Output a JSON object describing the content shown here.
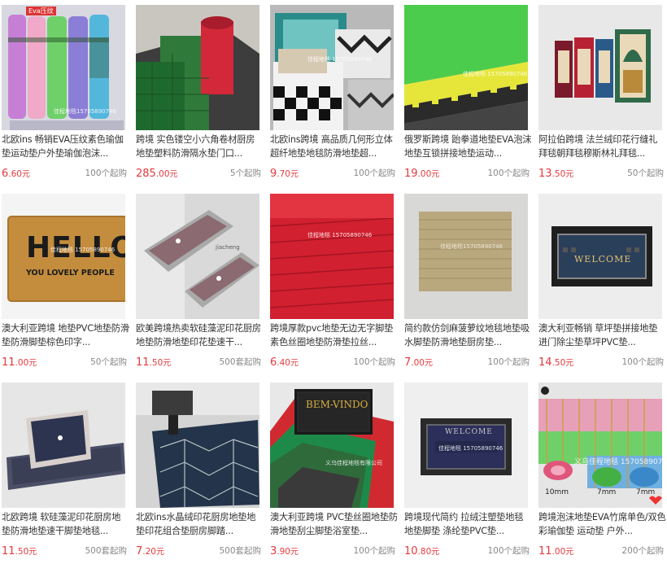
{
  "products": [
    {
      "title": "北欧ins 畅销EVA压纹素色瑜伽垫运动垫户外垫瑜伽泡沫...",
      "price_int": "6",
      "price_dec": ".60",
      "unit": "元",
      "moq": "100个起购",
      "watermark": "佳程地毯15705890746",
      "thumb_label": "Eva压纹"
    },
    {
      "title": "跨境 实色镂空小六角卷材厨房地垫塑料防滑隔水垫门口...",
      "price_int": "285",
      "price_dec": ".00",
      "unit": "元",
      "moq": "5个起购"
    },
    {
      "title": "北欧ins跨境 高品质几何形立体超纤地垫地毯防滑地垫超...",
      "price_int": "9",
      "price_dec": ".70",
      "unit": "元",
      "moq": "100个起购",
      "watermark": "佳程地毯 15705890746"
    },
    {
      "title": "俄罗斯跨境 跆拳道地垫EVA泡沫地垫互锁拼接地垫运动...",
      "price_int": "19",
      "price_dec": ".00",
      "unit": "元",
      "moq": "100个起购",
      "watermark": "佳程地毯 15705890746"
    },
    {
      "title": "阿拉伯跨境 法兰绒印花行缝礼拜毯朝拜毯穆斯林礼拜毯...",
      "price_int": "13",
      "price_dec": ".50",
      "unit": "元",
      "moq": "50个起购"
    },
    {
      "title": "澳大利亚跨境 地垫PVC地垫防滑垫防滑脚垫棕色印字...",
      "price_int": "11",
      "price_dec": ".00",
      "unit": "元",
      "moq": "50个起购",
      "watermark": "佳程地毯 15705890746",
      "mat_text_1": "HELLO",
      "mat_text_2": "YOU LOVELY PEOPLE"
    },
    {
      "title": "欧美跨境热卖软硅藻泥印花厨房地垫防滑地垫印花垫速干...",
      "price_int": "11",
      "price_dec": ".50",
      "unit": "元",
      "moq": "500套起购",
      "watermark": "jiacheng"
    },
    {
      "title": "跨境厚款pvc地垫无边无字脚垫素色丝圈地垫防滑垫拉丝...",
      "price_int": "6",
      "price_dec": ".40",
      "unit": "元",
      "moq": "100个起购",
      "watermark": "佳程地毯 15705890746"
    },
    {
      "title": "简约款仿剑麻菠萝纹地毯地垫吸水脚垫防滑地垫厨房垫...",
      "price_int": "7",
      "price_dec": ".00",
      "unit": "元",
      "moq": "100个起购",
      "watermark": "佳程地毯15705890746"
    },
    {
      "title": "澳大利亚畅销 草坪垫拼接地垫进门除尘垫草坪PVC垫...",
      "price_int": "14",
      "price_dec": ".50",
      "unit": "元",
      "moq": "100个起购",
      "mat_text_1": "WELCOME"
    },
    {
      "title": "北欧跨境 软硅藻泥印花厨房地垫防滑地垫速干脚垫地毯...",
      "price_int": "11",
      "price_dec": ".50",
      "unit": "元",
      "moq": "500套起购"
    },
    {
      "title": "北欧ins水晶绒印花厨房地垫地垫印花组合垫厨房脚踏...",
      "price_int": "7",
      "price_dec": ".20",
      "unit": "元",
      "moq": "500套起购"
    },
    {
      "title": "澳大利亚跨境 PVC垫丝圈地垫防滑地垫刮尘脚垫浴室垫...",
      "price_int": "3",
      "price_dec": ".90",
      "unit": "元",
      "moq": "100个起购",
      "watermark": "义乌佳程地毯有限公司",
      "mat_text_1": "BEM-VINDO"
    },
    {
      "title": "跨境现代简约 拉绒注塑垫地毯地垫脚垫 涤纶垫PVC垫...",
      "price_int": "10",
      "price_dec": ".80",
      "unit": "元",
      "moq": "100个起购",
      "watermark": "佳程地毯 15705890746",
      "mat_text_1": "WELCOME"
    },
    {
      "title": "跨境泡沫地垫EVA竹席单色/双色彩瑜伽垫 运动垫 户外...",
      "price_int": "11",
      "price_dec": ".00",
      "unit": "元",
      "moq": "200个起购",
      "watermark": "义乌佳程地毯 15705890746",
      "size_1": "10mm",
      "size_2": "7mm",
      "size_3": "7mm"
    }
  ]
}
